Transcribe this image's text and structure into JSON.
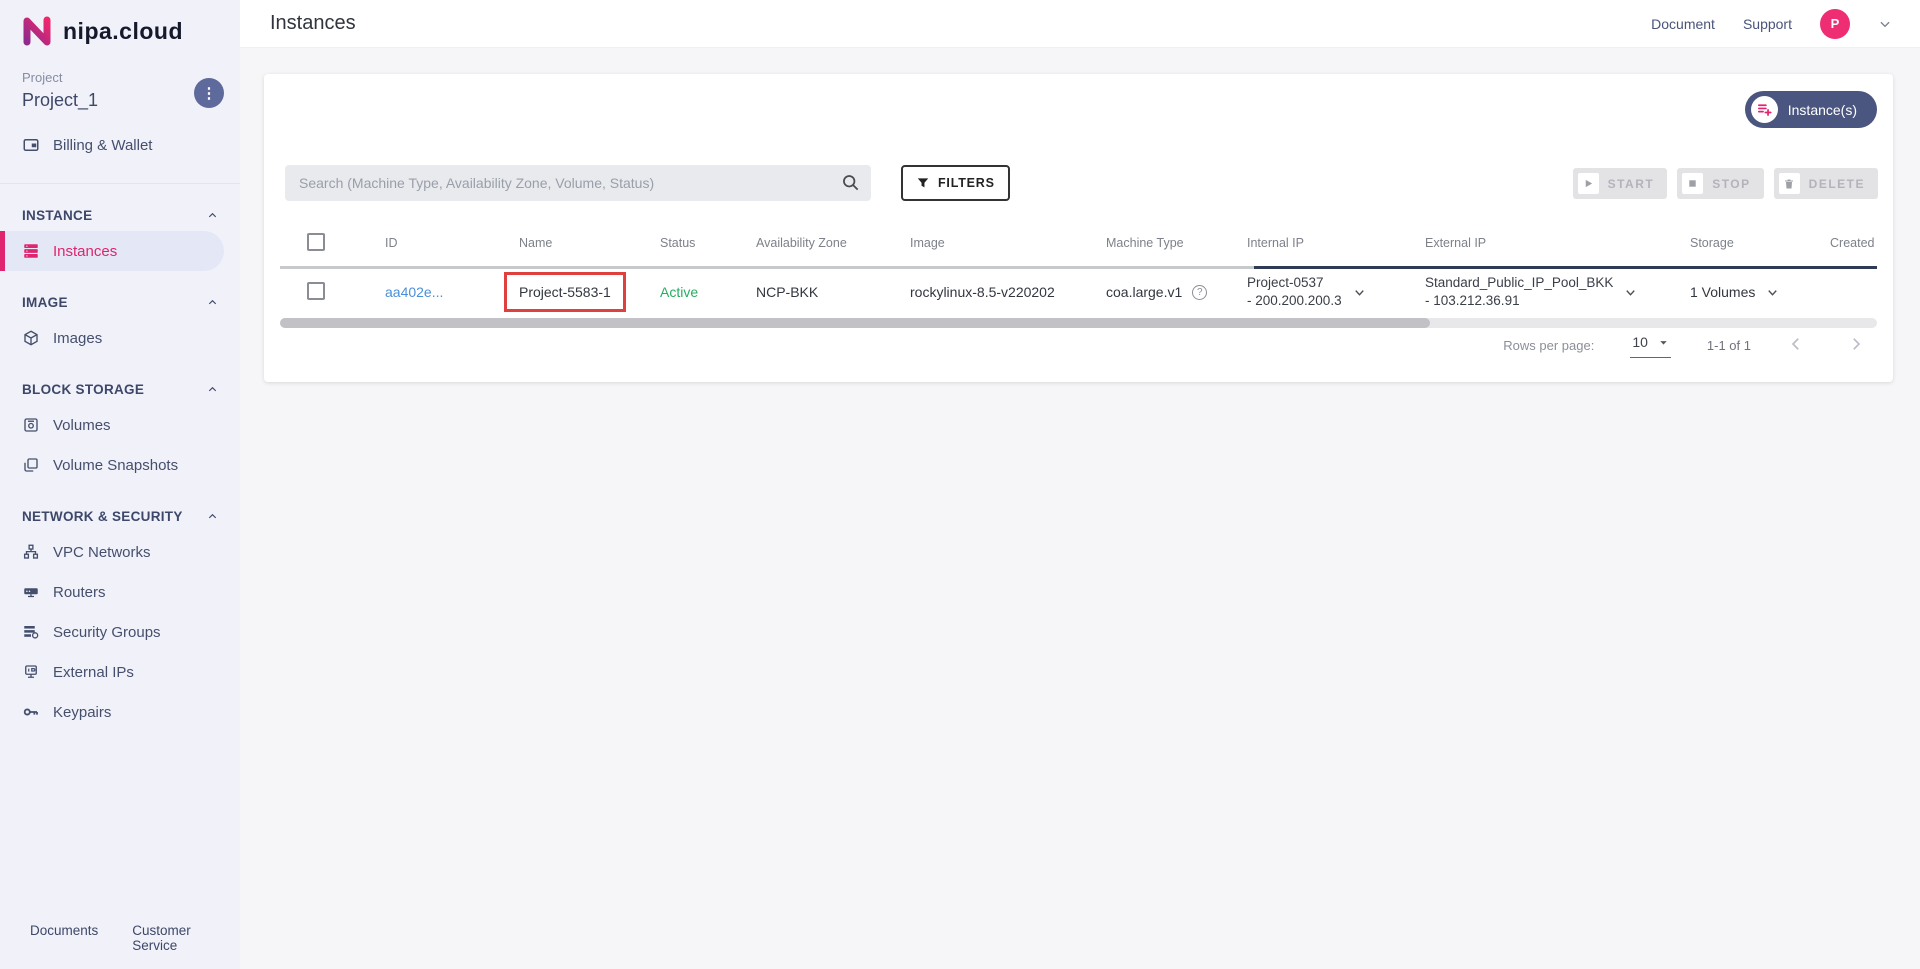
{
  "brand": {
    "logo_letter": "N",
    "name": "nipa.cloud"
  },
  "sidebar": {
    "project_label": "Project",
    "project_name": "Project_1",
    "billing_label": "Billing & Wallet",
    "sections": [
      {
        "label": "INSTANCE",
        "items": [
          {
            "label": "Instances",
            "icon": "server-icon",
            "active": true
          }
        ]
      },
      {
        "label": "IMAGE",
        "items": [
          {
            "label": "Images",
            "icon": "cube-icon"
          }
        ]
      },
      {
        "label": "BLOCK STORAGE",
        "items": [
          {
            "label": "Volumes",
            "icon": "hard-drive-icon"
          },
          {
            "label": "Volume Snapshots",
            "icon": "snapshot-icon"
          }
        ]
      },
      {
        "label": "NETWORK & SECURITY",
        "items": [
          {
            "label": "VPC Networks",
            "icon": "sitemap-icon"
          },
          {
            "label": "Routers",
            "icon": "router-icon"
          },
          {
            "label": "Security Groups",
            "icon": "security-list-icon"
          },
          {
            "label": "External IPs",
            "icon": "external-ip-icon"
          },
          {
            "label": "Keypairs",
            "icon": "key-icon"
          }
        ]
      }
    ],
    "footer_links": [
      "Documents",
      "Customer Service"
    ]
  },
  "header": {
    "title": "Instances",
    "links": [
      "Document",
      "Support"
    ],
    "avatar_initial": "P"
  },
  "toolbar": {
    "create_button": "Instance(s)",
    "search_placeholder": "Search (Machine Type, Availability Zone, Volume, Status)",
    "filters_label": "FILTERS",
    "actions": [
      {
        "label": "START",
        "icon": "play-icon"
      },
      {
        "label": "STOP",
        "icon": "stop-icon"
      },
      {
        "label": "DELETE",
        "icon": "trash-icon"
      }
    ]
  },
  "table": {
    "columns": [
      "ID",
      "Name",
      "Status",
      "Availability Zone",
      "Image",
      "Machine Type",
      "Internal IP",
      "External IP",
      "Storage",
      "Created"
    ],
    "rows": [
      {
        "id": "aa402e...",
        "name": "Project-5583-1",
        "status": "Active",
        "availability_zone": "NCP-BKK",
        "image": "rockylinux-8.5-v220202",
        "machine_type": "coa.large.v1",
        "internal_ip_line1": "Project-0537",
        "internal_ip_line2": "- 200.200.200.3",
        "external_ip_line1": "Standard_Public_IP_Pool_BKK",
        "external_ip_line2": "- 103.212.36.91",
        "storage": "1 Volumes"
      }
    ]
  },
  "pagination": {
    "rows_per_page_label": "Rows per page:",
    "rows_per_page_value": "10",
    "range_label": "1-1 of 1"
  },
  "colors": {
    "accent_pink": "#e0256f",
    "navy_button": "#4a5680",
    "active_green": "#27ae60",
    "link_blue": "#4a90d9",
    "annotation_red": "#e0403d",
    "sidebar_bg": "#f1f2f9"
  }
}
